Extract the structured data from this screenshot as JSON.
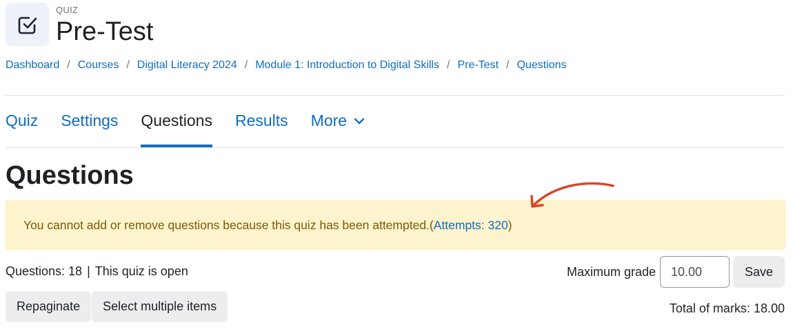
{
  "header": {
    "kicker": "QUIZ",
    "title": "Pre-Test",
    "icon": "checkbox-icon"
  },
  "breadcrumb": [
    "Dashboard",
    "Courses",
    "Digital Literacy 2024",
    "Module 1: Introduction to Digital Skills",
    "Pre-Test",
    "Questions"
  ],
  "breadcrumb_separator": "/",
  "tabs": [
    {
      "label": "Quiz",
      "active": false
    },
    {
      "label": "Settings",
      "active": false
    },
    {
      "label": "Questions",
      "active": true
    },
    {
      "label": "Results",
      "active": false
    },
    {
      "label": "More",
      "active": false,
      "icon": "chevron-down-icon"
    }
  ],
  "section_heading": "Questions",
  "alert": {
    "text": "You cannot add or remove questions because this quiz has been attempted. ",
    "open_paren": "(",
    "link": "Attempts: 320",
    "close_paren": ")",
    "annotation_icon": "curved-arrow-icon"
  },
  "status": {
    "questions": "Questions: 18",
    "separator": "|",
    "state": "This quiz is open"
  },
  "grade": {
    "label": "Maximum grade",
    "value": "10.00",
    "save_label": "Save"
  },
  "actions": {
    "repaginate_label": "Repaginate",
    "select_multiple_label": "Select multiple items"
  },
  "total_marks": "Total of marks: 18.00",
  "colors": {
    "link": "#0f6cbf",
    "alert_bg": "#fdf3cd",
    "alert_text": "#7a5b06",
    "annotation": "#d9472b",
    "button_bg": "#ebedef"
  }
}
